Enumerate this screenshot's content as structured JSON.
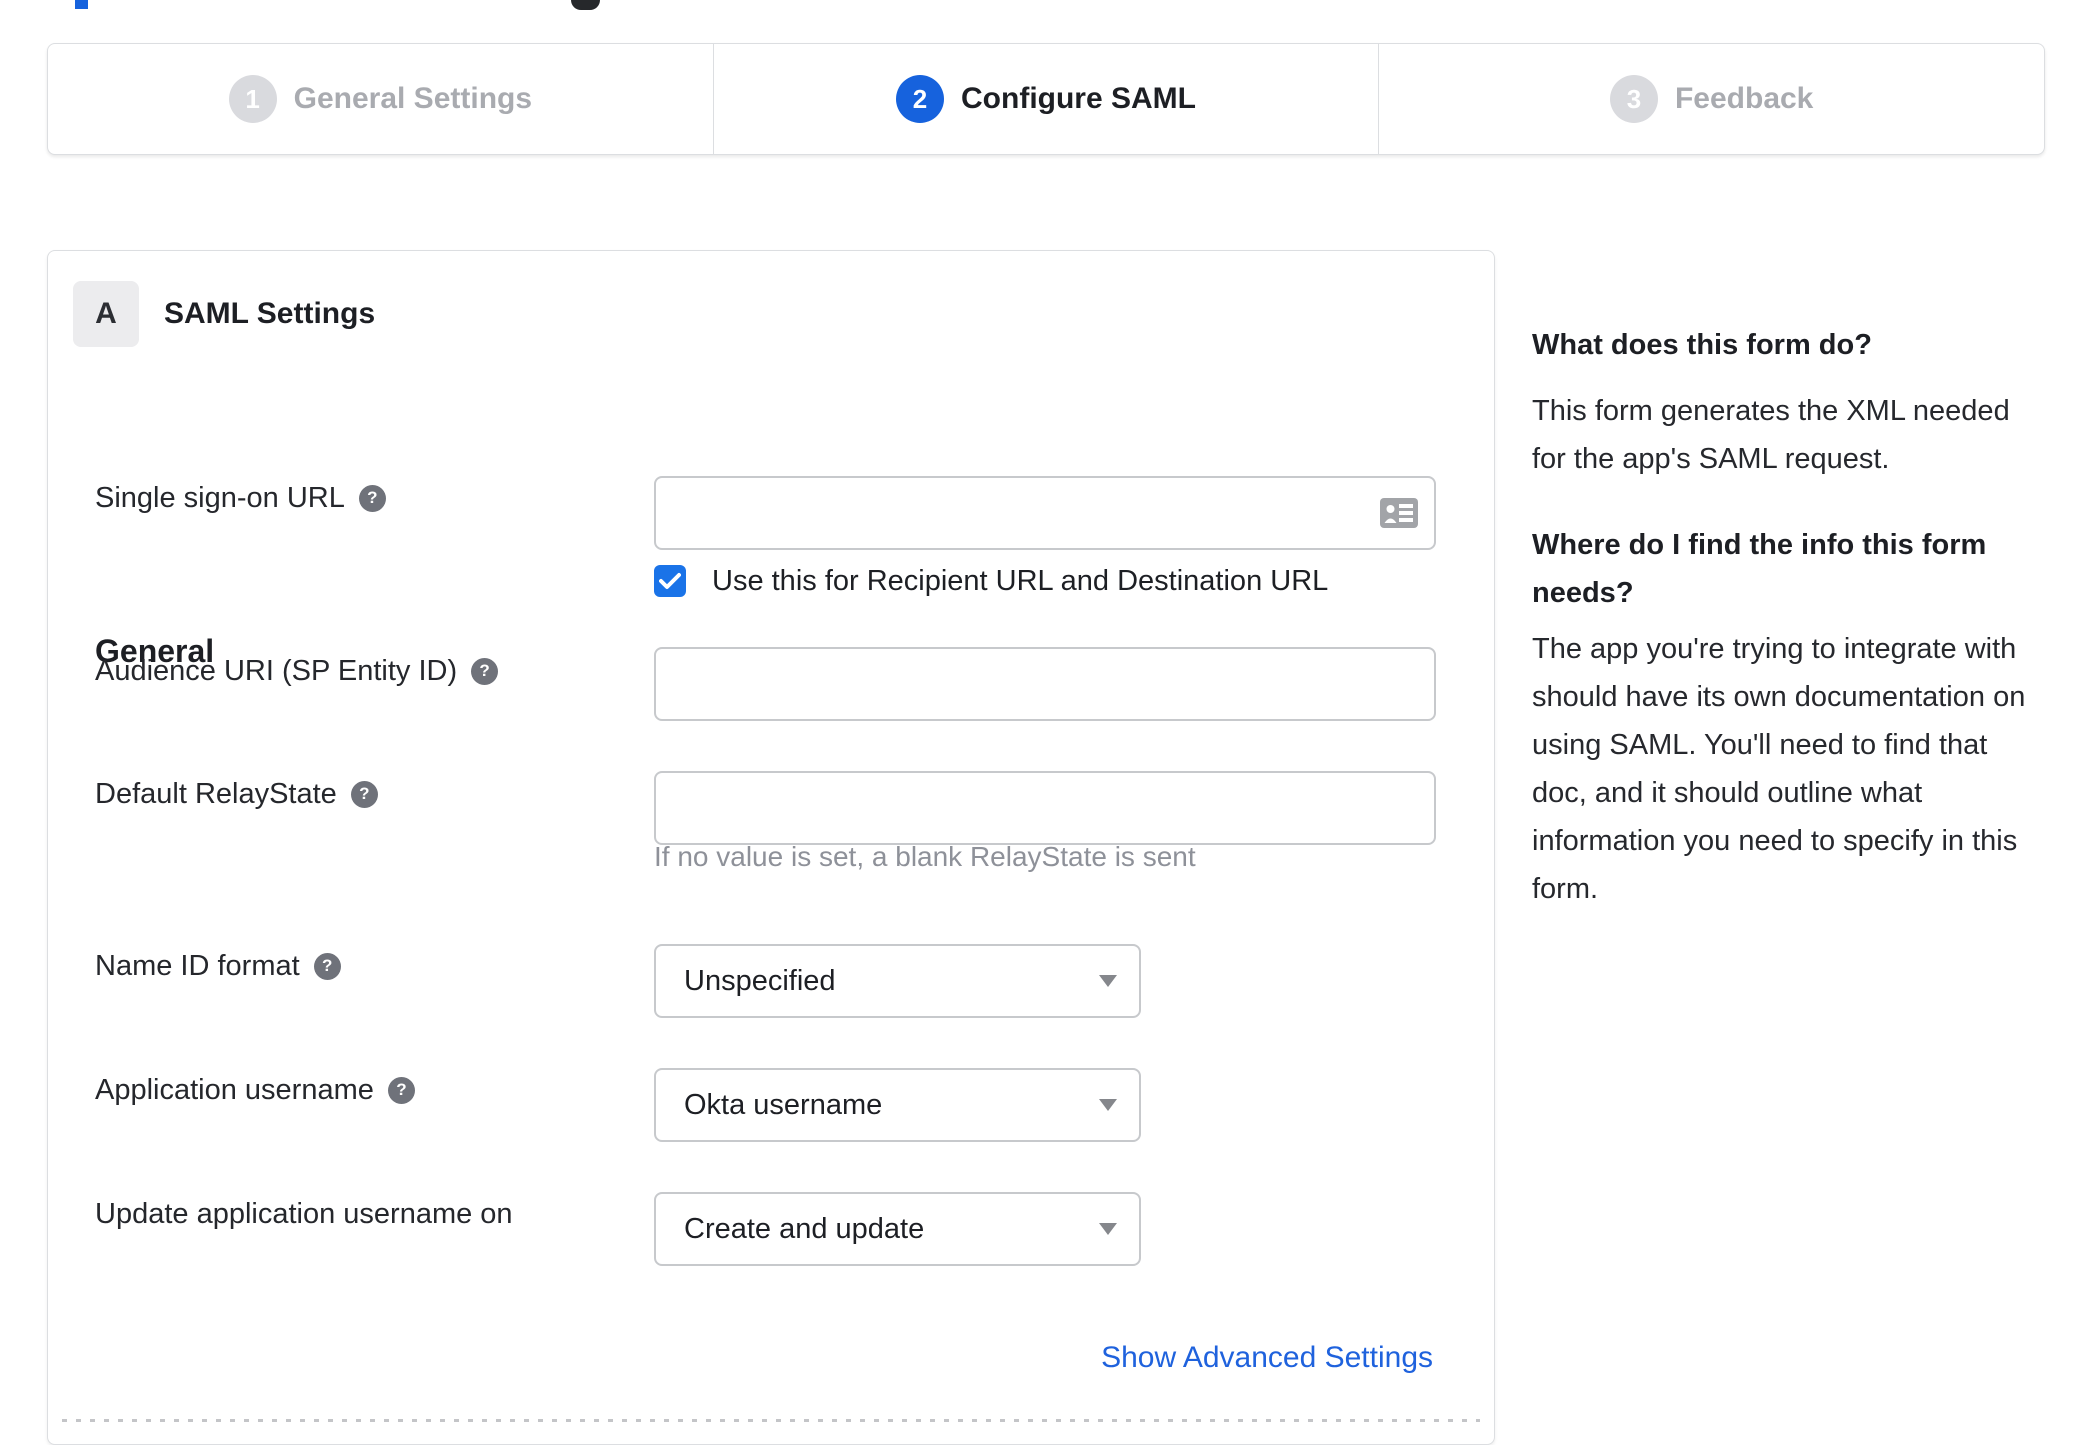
{
  "colors": {
    "accent_blue": "#1662dd",
    "checkbox_blue": "#1a73e8",
    "link_blue": "#1f62dd",
    "inactive_gray": "#d9dade",
    "inactive_label_gray": "#a9abb0",
    "border_gray": "#dcdee1",
    "input_border": "#c7c9cc",
    "help_icon_gray": "#6f727a",
    "hint_gray": "#8e9199"
  },
  "stepper": {
    "steps": [
      {
        "number": "1",
        "label": "General Settings",
        "state": "inactive"
      },
      {
        "number": "2",
        "label": "Configure SAML",
        "state": "active"
      },
      {
        "number": "3",
        "label": "Feedback",
        "state": "inactive"
      }
    ]
  },
  "panel": {
    "section_badge": "A",
    "section_title": "SAML Settings",
    "group_heading": "General",
    "fields": [
      {
        "label": "Single sign-on URL",
        "has_help": true,
        "type": "text",
        "value": "",
        "trailing_icon": "contact-card-icon",
        "checkbox": {
          "checked": true,
          "label": "Use this for Recipient URL and Destination URL"
        }
      },
      {
        "label": "Audience URI (SP Entity ID)",
        "has_help": true,
        "type": "text",
        "value": ""
      },
      {
        "label": "Default RelayState",
        "has_help": true,
        "type": "text",
        "value": "",
        "hint": "If no value is set, a blank RelayState is sent"
      },
      {
        "label": "Name ID format",
        "has_help": true,
        "type": "select",
        "value": "Unspecified"
      },
      {
        "label": "Application username",
        "has_help": true,
        "type": "select",
        "value": "Okta username"
      },
      {
        "label": "Update application username on",
        "has_help": false,
        "type": "select",
        "value": "Create and update"
      }
    ],
    "advanced_link": "Show Advanced Settings"
  },
  "sidebar": {
    "heading1": "What does this form do?",
    "para1": "This form generates the XML needed\nfor the app's SAML request.",
    "heading2": "Where do I find the info this form\nneeds?",
    "para2": "The app you're trying to integrate with\nshould have its own documentation on\nusing SAML. You'll need to find that\ndoc, and it should outline what\ninformation you need to specify in this\nform."
  }
}
